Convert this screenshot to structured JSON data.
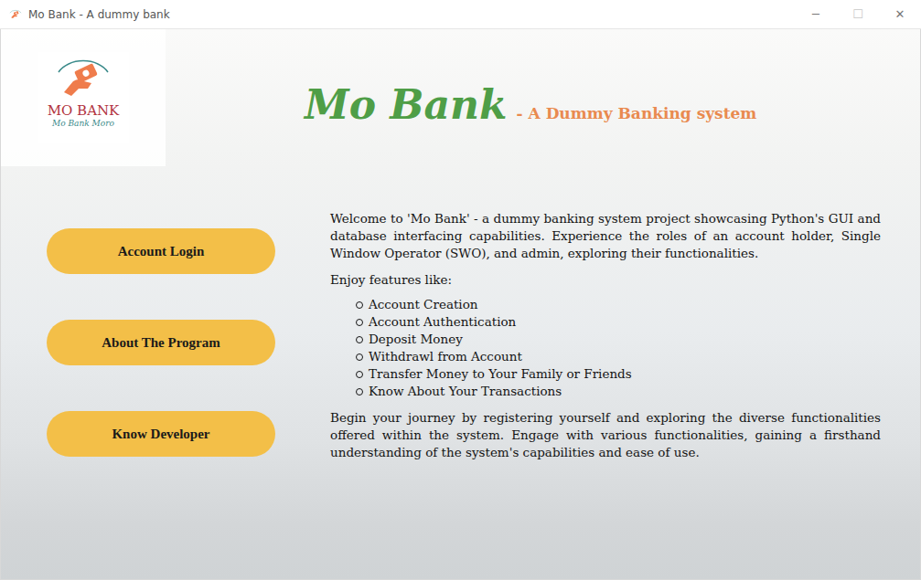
{
  "window": {
    "title": "Mo Bank - A dummy bank",
    "controls": [
      {
        "label": "─",
        "disabled": false
      },
      {
        "label": "☐",
        "disabled": true
      },
      {
        "label": "✕",
        "disabled": false
      }
    ]
  },
  "logo": {
    "name": "MO BANK",
    "tagline": "Mo Bank Moro"
  },
  "header": {
    "title": "Mo Bank",
    "subtitle": "- A Dummy Banking system"
  },
  "menu": [
    {
      "label": "Account Login"
    },
    {
      "label": "About The Program"
    },
    {
      "label": "Know Developer"
    }
  ],
  "intro": {
    "paragraph": "Welcome to 'Mo Bank' - a dummy banking system project showcasing Python's GUI and database interfacing capabilities. Experience the roles of an account holder, Single Window Operator (SWO), and admin, exploring their functionalities.",
    "features_heading": "Enjoy features like:",
    "features": [
      "Account Creation",
      "Account Authentication",
      "Deposit Money",
      "Withdrawl from Account",
      "Transfer Money to Your Family or Friends",
      "Know About Your Transactions"
    ],
    "closing": "Begin your journey by registering yourself and exploring the diverse functionalities offered within the system. Engage with various functionalities, gaining a firsthand understanding of the system's capabilities and ease of use."
  }
}
